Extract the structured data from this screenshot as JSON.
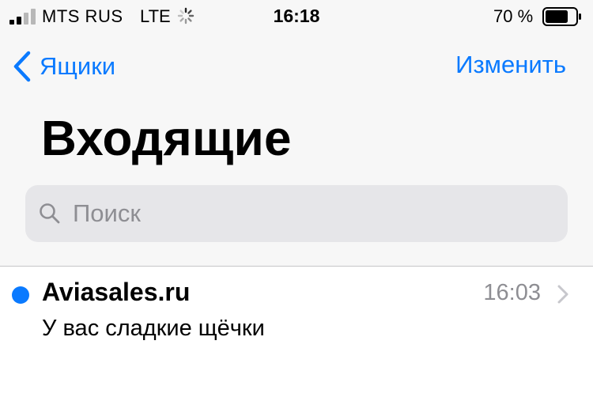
{
  "status_bar": {
    "carrier": "MTS RUS",
    "network": "LTE",
    "time": "16:18",
    "battery_percent": "70 %",
    "battery_level": 0.7,
    "signal_bars": 2
  },
  "nav": {
    "back_label": "Ящики",
    "edit_label": "Изменить"
  },
  "title": "Входящие",
  "search": {
    "placeholder": "Поиск"
  },
  "messages": [
    {
      "sender": "Aviasales.ru",
      "time": "16:03",
      "subject": "У вас сладкие щёчки",
      "unread": true
    }
  ],
  "colors": {
    "accent": "#0a7aff",
    "secondary_text": "#8e8e93",
    "search_bg": "#e6e6e9",
    "header_bg": "#f7f7f7"
  }
}
